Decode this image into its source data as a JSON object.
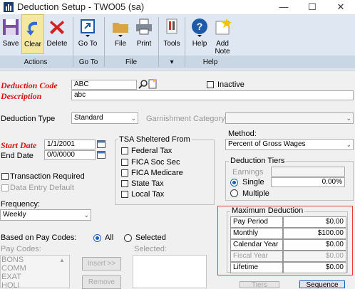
{
  "window": {
    "title": "Deduction Setup  -  TWO05 (sa)",
    "minimize": "—",
    "maximize": "☐",
    "close": "✕"
  },
  "ribbon": {
    "buttons": [
      {
        "label": "Save",
        "icon": "save-icon"
      },
      {
        "label": "Clear",
        "icon": "clear-icon"
      },
      {
        "label": "Delete",
        "icon": "delete-icon"
      },
      {
        "label": "Go To",
        "icon": "goto-icon"
      },
      {
        "label": "File",
        "icon": "folder-icon"
      },
      {
        "label": "Print",
        "icon": "printer-icon"
      },
      {
        "label": "Tools",
        "icon": "tools-icon"
      },
      {
        "label": "Help",
        "icon": "help-icon"
      },
      {
        "label": "Add\nNote",
        "icon": "note-icon"
      }
    ],
    "groups": [
      "Actions",
      "Go To",
      "File",
      "",
      "Help"
    ]
  },
  "form": {
    "deduction_code_label": "Deduction Code",
    "deduction_code": "ABC",
    "inactive_label": "Inactive",
    "description_label": "Description",
    "description": "abc",
    "deduction_type_label": "Deduction Type",
    "deduction_type": "Standard",
    "garnishment_label": "Garnishment Category",
    "garnishment_value": "",
    "start_date_label": "Start Date",
    "start_date": "1/1/2001",
    "end_date_label": "End Date",
    "end_date": "0/0/0000",
    "tsa_label": "TSA Sheltered From",
    "tsa_items": [
      "Federal Tax",
      "FICA Soc Sec",
      "FICA Medicare",
      "State Tax",
      "Local Tax"
    ],
    "transaction_required": "Transaction Required",
    "data_entry_default": "Data Entry Default",
    "frequency_label": "Frequency:",
    "frequency": "Weekly",
    "method_label": "Method:",
    "method": "Percent of Gross Wages",
    "tiers_label": "Deduction Tiers",
    "earnings_label": "Earnings",
    "single_label": "Single",
    "single_value": "0.00%",
    "multiple_label": "Multiple",
    "based_on_label": "Based on Pay Codes:",
    "all_label": "All",
    "selected_label": "Selected",
    "pay_codes_label": "Pay Codes:",
    "selected_list_label": "Selected:",
    "pay_codes": [
      "BONS",
      "COMM",
      "EXAT",
      "HOLI"
    ],
    "insert_btn": "Insert >>",
    "remove_btn": "Remove",
    "tiers_btn": "Tiers",
    "sequence_btn": "Sequence"
  },
  "max_deduction": {
    "title": "Maximum Deduction",
    "rows": [
      {
        "label": "Pay Period",
        "value": "$0.00",
        "disabled": false
      },
      {
        "label": "Monthly",
        "value": "$100.00",
        "disabled": false
      },
      {
        "label": "Calendar Year",
        "value": "$0.00",
        "disabled": false
      },
      {
        "label": "Fiscal Year",
        "value": "$0.00",
        "disabled": true
      },
      {
        "label": "Lifetime",
        "value": "$0.00",
        "disabled": false
      }
    ]
  },
  "colors": {
    "required_label": "#dd1111",
    "highlight_box": "#e04040",
    "radio_accent": "#1a5fb4"
  }
}
